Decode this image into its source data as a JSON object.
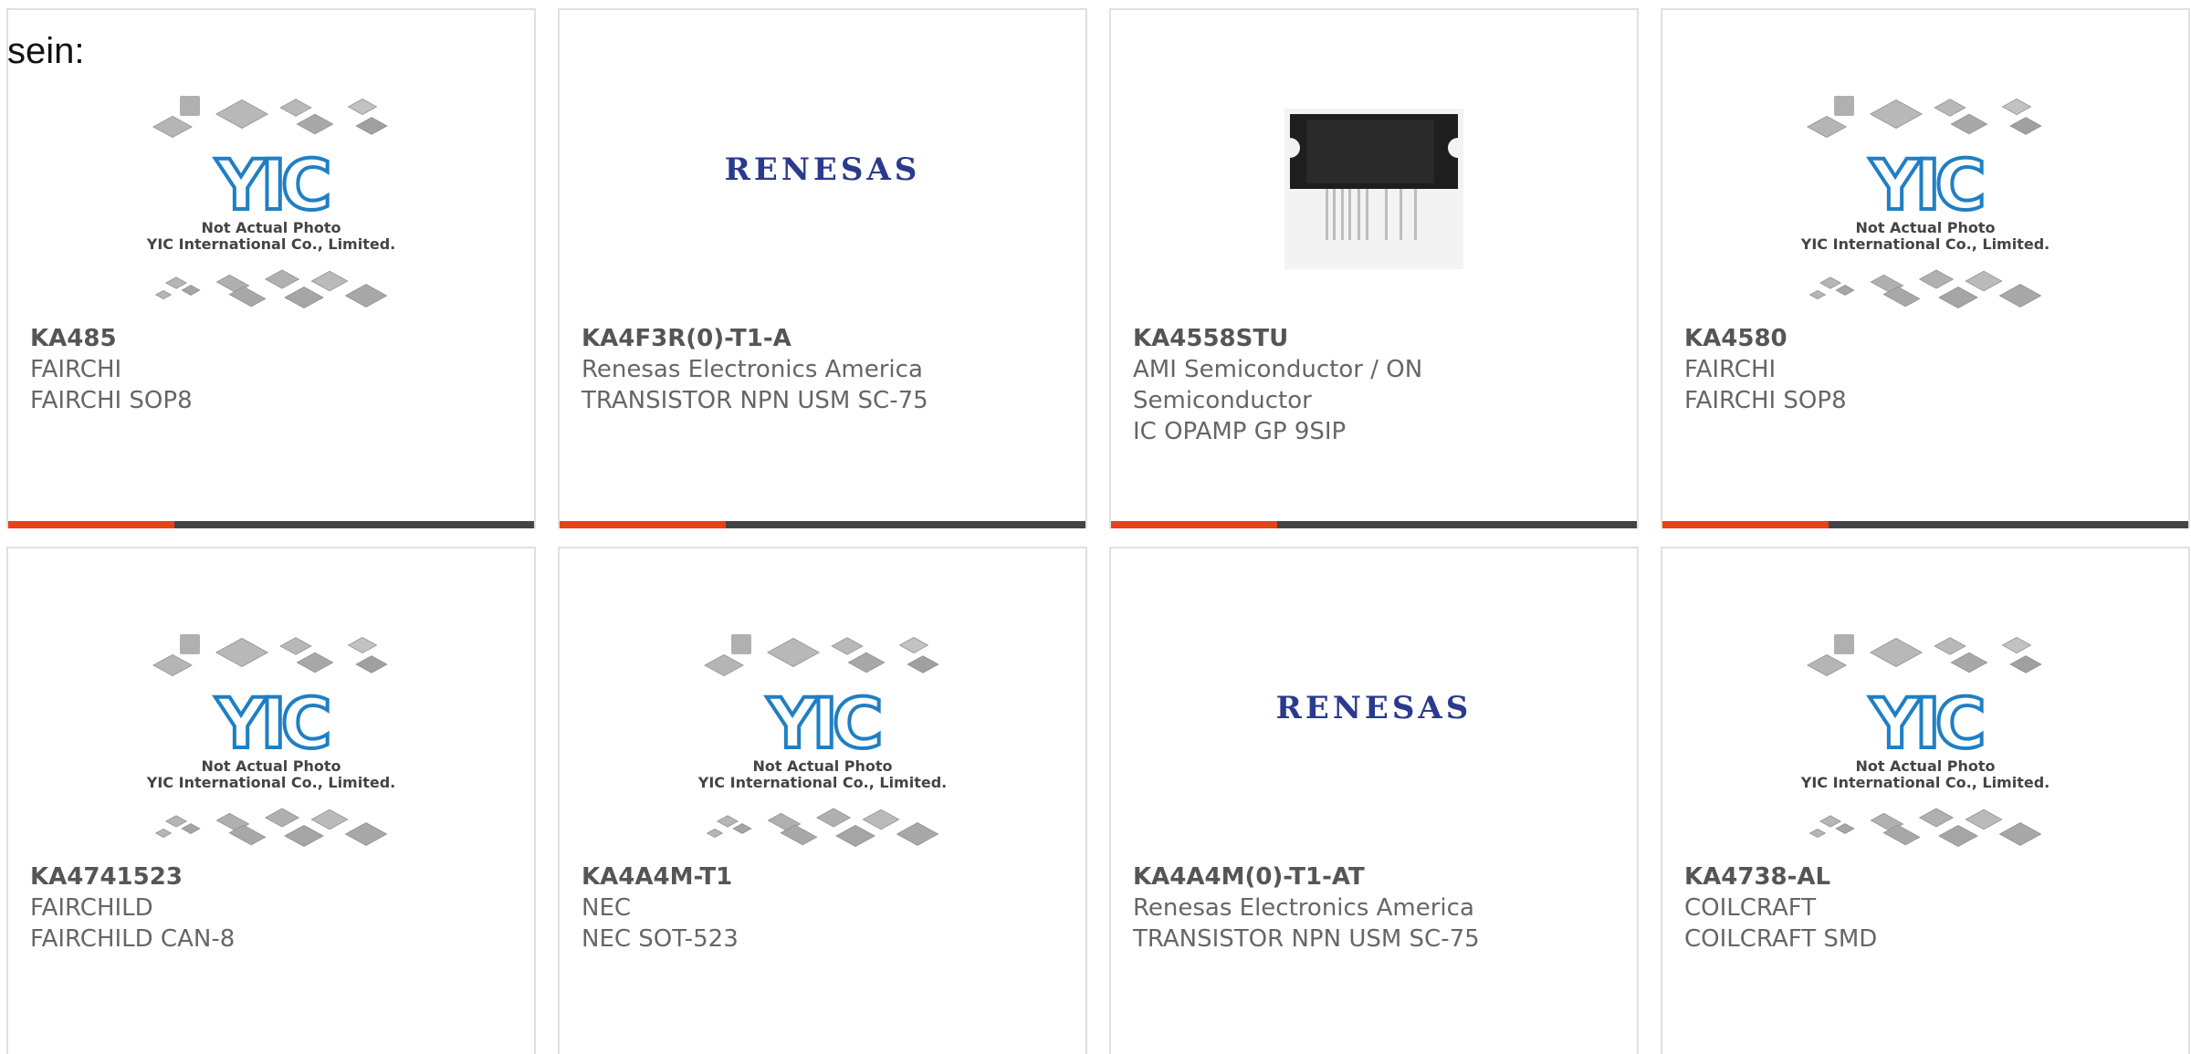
{
  "intro_text": "sein:",
  "placeholder": {
    "brand": "YIC",
    "line1": "Not Actual Photo",
    "line2": "YIC International Co., Limited."
  },
  "renesas_logo_text": "RENESAS",
  "colors": {
    "accent": "#e8421b",
    "bar": "#444444",
    "yic_blue": "#1f7fc4",
    "renesas_navy": "#2a3a8c"
  },
  "products": [
    {
      "part": "KA485",
      "manufacturer": "FAIRCHI",
      "description": "FAIRCHI SOP8",
      "image": "yic-placeholder"
    },
    {
      "part": "KA4F3R(0)-T1-A",
      "manufacturer": "Renesas Electronics America",
      "description": "TRANSISTOR NPN USM SC-75",
      "image": "renesas-logo"
    },
    {
      "part": "KA4558STU",
      "manufacturer_line1": "AMI Semiconductor / ON",
      "manufacturer_line2": "Semiconductor",
      "description": "IC OPAMP GP 9SIP",
      "image": "sip-package-photo"
    },
    {
      "part": "KA4580",
      "manufacturer": "FAIRCHI",
      "description": "FAIRCHI SOP8",
      "image": "yic-placeholder"
    },
    {
      "part": "KA4741523",
      "manufacturer": "FAIRCHILD",
      "description": "FAIRCHILD CAN-8",
      "image": "yic-placeholder"
    },
    {
      "part": "KA4A4M-T1",
      "manufacturer": "NEC",
      "description": "NEC SOT-523",
      "image": "yic-placeholder"
    },
    {
      "part": "KA4A4M(0)-T1-AT",
      "manufacturer": "Renesas Electronics America",
      "description": "TRANSISTOR NPN USM SC-75",
      "image": "renesas-logo"
    },
    {
      "part": "KA4738-AL",
      "manufacturer": "COILCRAFT",
      "description": "COILCRAFT SMD",
      "image": "yic-placeholder"
    }
  ]
}
